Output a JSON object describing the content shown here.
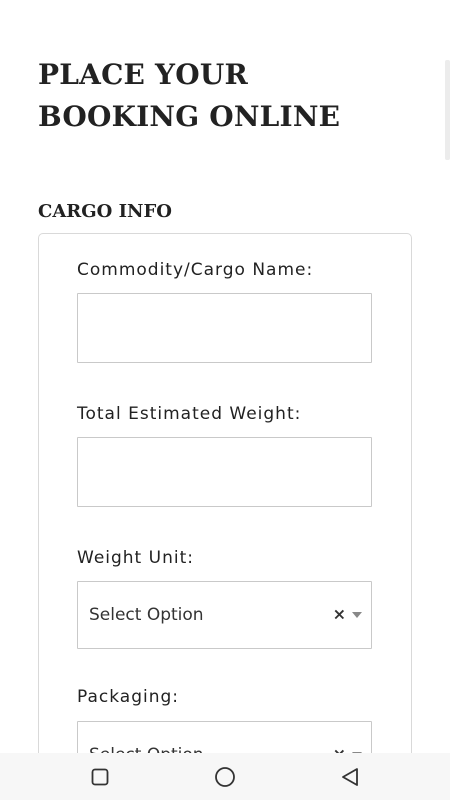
{
  "header": {
    "title": "PLACE YOUR BOOKING ONLINE"
  },
  "cargo_info": {
    "section_title": "CARGO INFO",
    "fields": [
      {
        "label": "Commodity/Cargo Name:",
        "value": ""
      },
      {
        "label": "Total Estimated Weight:",
        "value": ""
      },
      {
        "label": "Weight Unit:",
        "selected": "Select Option",
        "clear_symbol": "×"
      },
      {
        "label": "Packaging:",
        "selected": "Select Option",
        "clear_symbol": "×"
      }
    ]
  },
  "navbar": {
    "icons": [
      "recent-apps-icon",
      "home-icon",
      "back-icon"
    ]
  },
  "colors": {
    "text": "#222222",
    "border": "#c9c9c9",
    "card_border": "#d9d9d9",
    "navbar_bg": "#f7f7f7"
  }
}
